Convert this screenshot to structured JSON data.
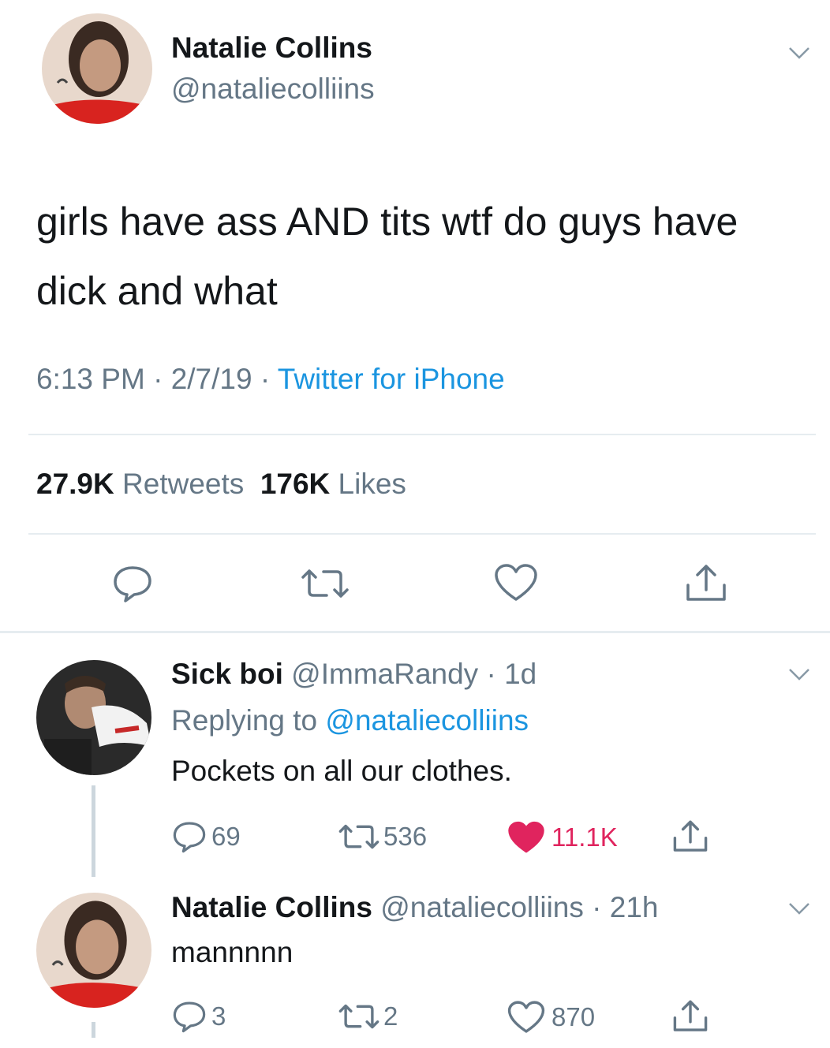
{
  "tweet": {
    "author_name": "Natalie Collins",
    "author_handle": "@nataliecolliins",
    "text": "girls have ass AND tits wtf do guys have dick and what",
    "time": "6:13 PM",
    "date": "2/7/19",
    "source": "Twitter for iPhone",
    "retweets_count": "27.9K",
    "retweets_label": "Retweets",
    "likes_count": "176K",
    "likes_label": "Likes"
  },
  "replies": [
    {
      "name": "Sick boi",
      "handle": "@ImmaRandy",
      "age": "1d",
      "replying_prefix": "Replying to",
      "replying_to": "@nataliecolliins",
      "text": "Pockets on all our clothes.",
      "reply_count": "69",
      "retweet_count": "536",
      "like_count": "11.1K",
      "liked": true
    },
    {
      "name": "Natalie Collins",
      "handle": "@nataliecolliins",
      "age": "21h",
      "text": "mannnnn",
      "reply_count": "3",
      "retweet_count": "2",
      "like_count": "870",
      "liked": false
    }
  ],
  "colors": {
    "link_blue": "#1b95e0",
    "secondary_gray": "#657786",
    "like_red": "#e0245e",
    "divider": "#e6ecf0"
  },
  "icons": [
    "chevron-down-icon",
    "reply-icon",
    "retweet-icon",
    "heart-icon",
    "share-icon"
  ]
}
